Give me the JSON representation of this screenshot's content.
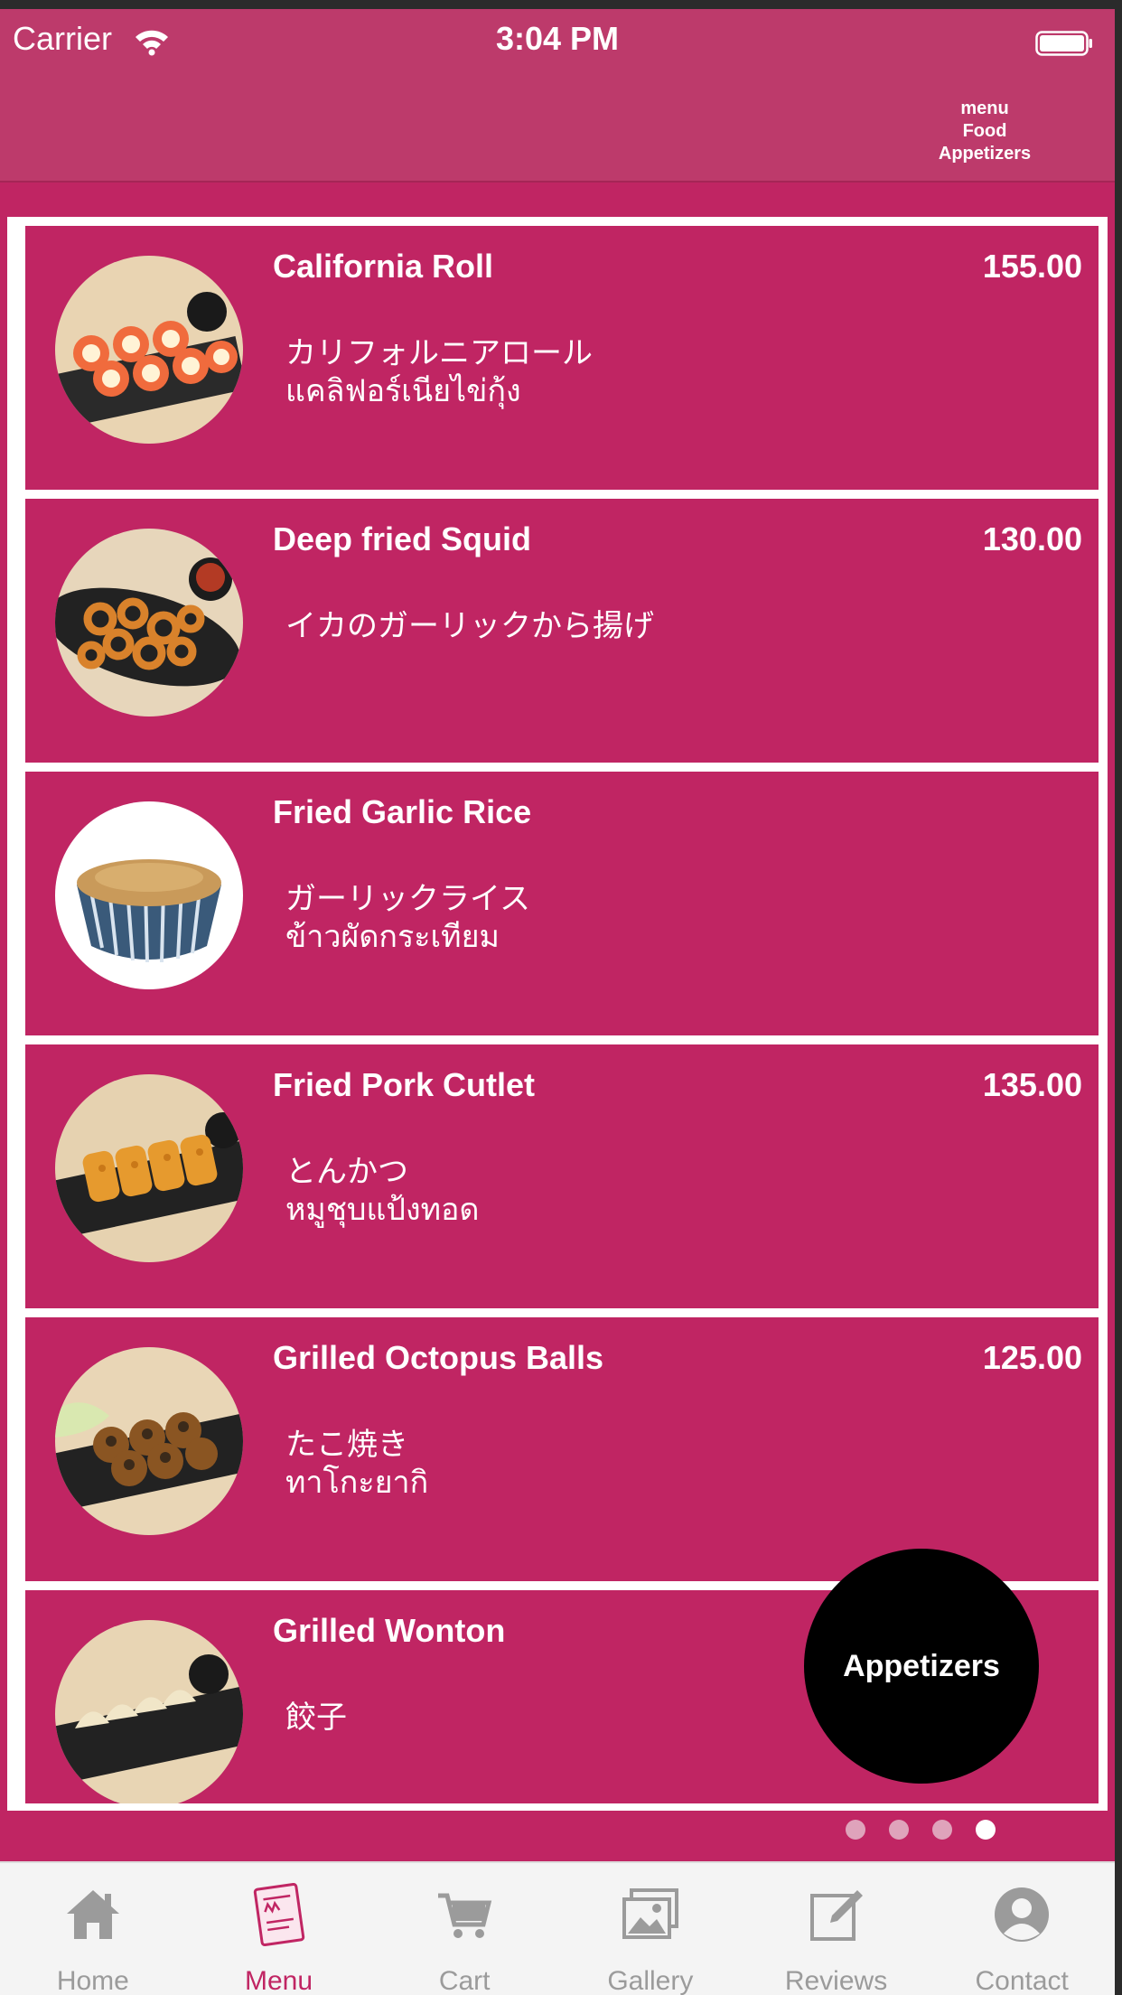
{
  "status_bar": {
    "carrier": "Carrier",
    "time": "3:04 PM"
  },
  "header": {
    "breadcrumb": [
      "menu",
      "Food",
      "Appetizers"
    ]
  },
  "items": [
    {
      "name": "California Roll",
      "price": "155.00",
      "subtitle_1": "カリフォルニアロール",
      "subtitle_2": "แคลิฟอร์เนียไข่กุ้ง"
    },
    {
      "name": "Deep fried Squid",
      "price": "130.00",
      "subtitle_1": "イカのガーリックから揚げ",
      "subtitle_2": ""
    },
    {
      "name": "Fried Garlic Rice",
      "price": "",
      "subtitle_1": "ガーリックライス",
      "subtitle_2": "ข้าวผัดกระเทียม"
    },
    {
      "name": "Fried Pork Cutlet",
      "price": "135.00",
      "subtitle_1": "とんかつ",
      "subtitle_2": "หมูชุบแป้งทอด"
    },
    {
      "name": "Grilled Octopus Balls",
      "price": "125.00",
      "subtitle_1": "たこ焼き",
      "subtitle_2": "ทาโกะยากิ"
    },
    {
      "name": "Grilled Wonton",
      "price": "",
      "subtitle_1": "餃子",
      "subtitle_2": ""
    }
  ],
  "fab": {
    "label": "Appetizers"
  },
  "pager": {
    "count": 4,
    "active_index": 3
  },
  "tabbar": {
    "tabs": [
      {
        "label": "Home",
        "icon": "home-icon"
      },
      {
        "label": "Menu",
        "icon": "menu-book-icon"
      },
      {
        "label": "Cart",
        "icon": "cart-icon"
      },
      {
        "label": "Gallery",
        "icon": "gallery-icon"
      },
      {
        "label": "Reviews",
        "icon": "edit-icon"
      },
      {
        "label": "Contact",
        "icon": "person-icon"
      }
    ],
    "active_index": 1
  },
  "colors": {
    "primary": "#c02563",
    "header": "#bd3a6b",
    "tab_inactive": "#9b9b9b"
  }
}
